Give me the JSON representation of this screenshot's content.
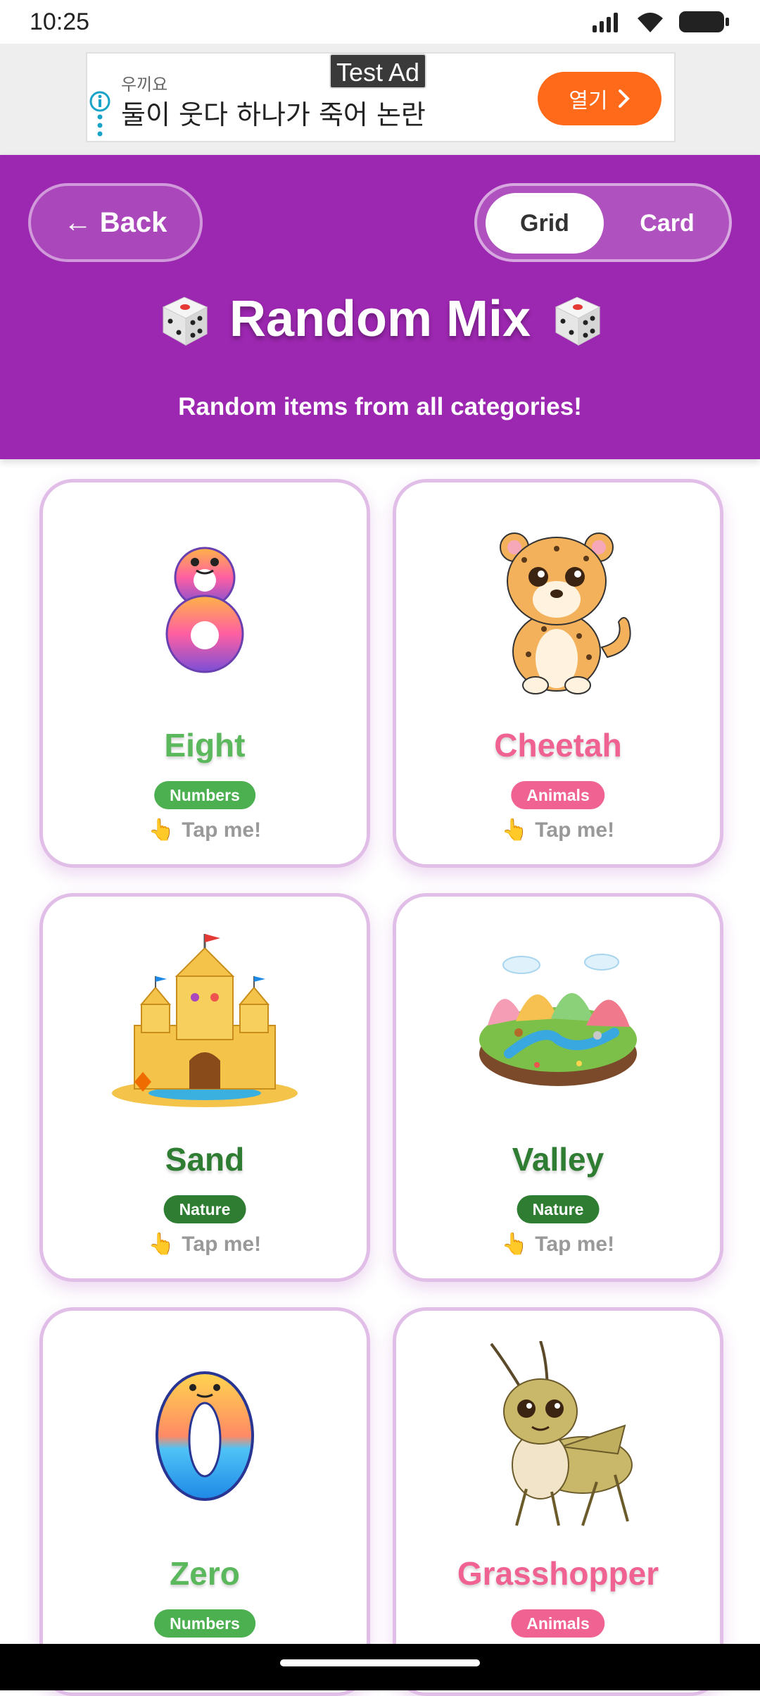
{
  "status_bar": {
    "time": "10:25"
  },
  "ad": {
    "advertiser": "우끼요",
    "headline": "둘이 웃다 하나가 죽어 논란",
    "test_label": "Test Ad",
    "open_label": "열기"
  },
  "header": {
    "back_label": "← Back",
    "toggle_grid": "Grid",
    "toggle_card": "Card",
    "title": "Random Mix",
    "subtitle": "Random items from all categories!"
  },
  "tap_label": "Tap me!",
  "items": [
    {
      "name": "Eight",
      "category": "Numbers",
      "color": "#5cb85c",
      "badge_color": "#4caf50",
      "icon": "number-eight-icon"
    },
    {
      "name": "Cheetah",
      "category": "Animals",
      "color": "#f06292",
      "badge_color": "#f06292",
      "icon": "cheetah-icon"
    },
    {
      "name": "Sand",
      "category": "Nature",
      "color": "#2e7d32",
      "badge_color": "#2e7d32",
      "icon": "sand-castle-icon"
    },
    {
      "name": "Valley",
      "category": "Nature",
      "color": "#2e7d32",
      "badge_color": "#2e7d32",
      "icon": "valley-icon"
    },
    {
      "name": "Zero",
      "category": "Numbers",
      "color": "#5cb85c",
      "badge_color": "#4caf50",
      "icon": "number-zero-icon"
    },
    {
      "name": "Grasshopper",
      "category": "Animals",
      "color": "#f06292",
      "badge_color": "#f06292",
      "icon": "grasshopper-icon"
    }
  ],
  "colors": {
    "header": "#9c27b0",
    "ad_button": "#ff6a1a",
    "card_border": "#e1bee7"
  }
}
